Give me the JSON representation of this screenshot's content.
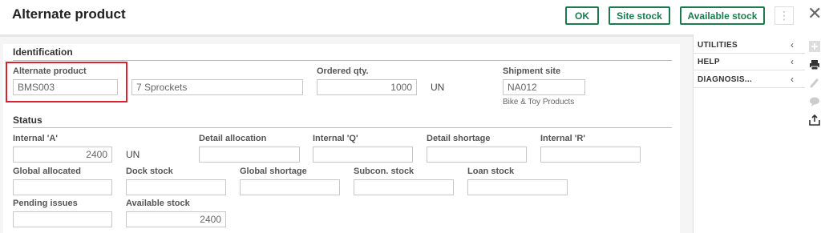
{
  "header": {
    "title": "Alternate product",
    "ok_label": "OK",
    "site_stock_label": "Site stock",
    "available_stock_label": "Available stock",
    "more_glyph": "⋮",
    "close_glyph": "✕"
  },
  "identification": {
    "section_title": "Identification",
    "alternate_product_label": "Alternate product",
    "alternate_product_value": "BMS003",
    "description_value": "7 Sprockets",
    "ordered_qty_label": "Ordered qty.",
    "ordered_qty_value": "1000",
    "ordered_qty_unit": "UN",
    "shipment_site_label": "Shipment site",
    "shipment_site_value": "NA012",
    "shipment_site_name": "Bike & Toy Products"
  },
  "status": {
    "section_title": "Status",
    "internal_a_label": "Internal 'A'",
    "internal_a_value": "2400",
    "internal_a_unit": "UN",
    "detail_allocation_label": "Detail allocation",
    "detail_allocation_value": "",
    "internal_q_label": "Internal 'Q'",
    "internal_q_value": "",
    "detail_shortage_label": "Detail shortage",
    "detail_shortage_value": "",
    "internal_r_label": "Internal 'R'",
    "internal_r_value": "",
    "global_allocated_label": "Global allocated",
    "global_allocated_value": "",
    "dock_stock_label": "Dock stock",
    "dock_stock_value": "",
    "global_shortage_label": "Global shortage",
    "global_shortage_value": "",
    "subcon_stock_label": "Subcon. stock",
    "subcon_stock_value": "",
    "loan_stock_label": "Loan stock",
    "loan_stock_value": "",
    "pending_issues_label": "Pending issues",
    "pending_issues_value": "",
    "available_stock_label": "Available stock",
    "available_stock_value": "2400"
  },
  "right_panel": {
    "items": [
      {
        "label": "UTILITIES",
        "chevron": "‹"
      },
      {
        "label": "HELP",
        "chevron": "‹"
      },
      {
        "label": "DIAGNOSIS...",
        "chevron": "‹"
      }
    ],
    "icons": [
      "plus-icon",
      "print-icon",
      "attachment-icon",
      "comment-icon",
      "export-icon"
    ]
  },
  "colors": {
    "accent": "#1b7a4e",
    "highlight": "#d9232e"
  }
}
